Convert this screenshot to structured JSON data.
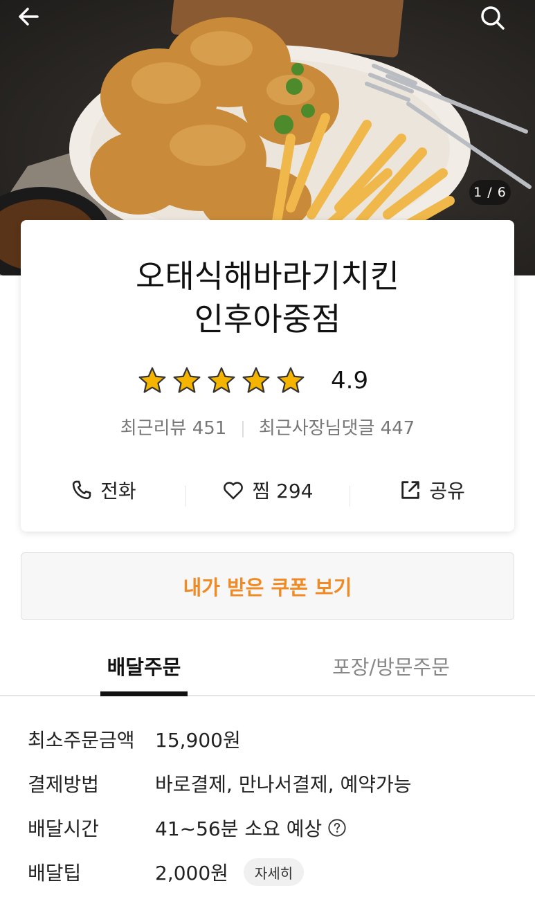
{
  "header": {
    "back_icon": "arrow-left-icon",
    "search_icon": "search-icon",
    "image_counter": "1 / 6"
  },
  "store": {
    "name_line1": "오태식해바라기치킨",
    "name_line2": "인후아중점",
    "rating": "4.9",
    "star_count": 5,
    "star_color": "#f5b400",
    "recent_reviews_label": "최근리뷰",
    "recent_reviews": "451",
    "owner_comments_label": "최근사장님댓글",
    "owner_comments": "447"
  },
  "actions": {
    "call_label": "전화",
    "like_label": "찜 294",
    "share_label": "공유"
  },
  "coupon": {
    "label": "내가 받은 쿠폰 보기",
    "color": "#f08a24"
  },
  "tabs": {
    "delivery": "배달주문",
    "pickup": "포장/방문주문",
    "active": "delivery"
  },
  "info": {
    "min_order_label": "최소주문금액",
    "min_order_value": "15,900원",
    "payment_label": "결제방법",
    "payment_value": "바로결제, 만나서결제, 예약가능",
    "delivery_time_label": "배달시간",
    "delivery_time_value": "41~56분 소요 예상",
    "delivery_tip_label": "배달팁",
    "delivery_tip_value": "2,000원",
    "detail_button": "자세히"
  }
}
